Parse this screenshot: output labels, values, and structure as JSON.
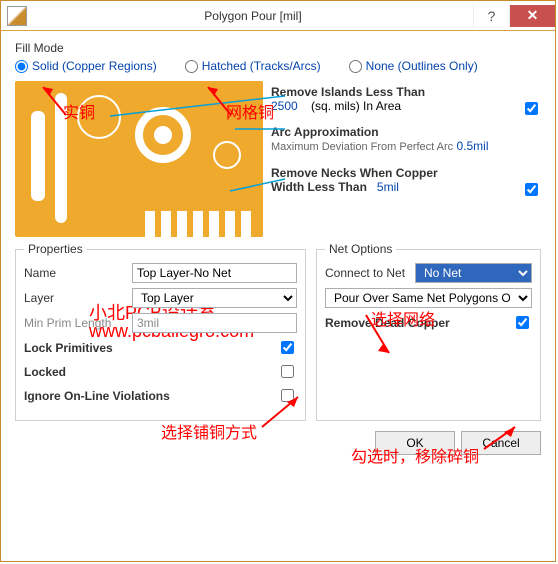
{
  "window": {
    "title": "Polygon Pour [mil]"
  },
  "fill_mode": {
    "label": "Fill Mode",
    "opts": {
      "solid": "Solid (Copper Regions)",
      "hatched": "Hatched (Tracks/Arcs)",
      "none": "None (Outlines Only)"
    },
    "selected": "solid"
  },
  "side": {
    "islands_hdr": "Remove Islands Less Than",
    "islands_val": "2500",
    "islands_unit": "(sq. mils)  In Area",
    "arc_hdr": "Arc Approximation",
    "arc_sub": "Maximum Deviation From Perfect Arc",
    "arc_val": "0.5mil",
    "necks_hdr": "Remove Necks When Copper",
    "necks_sub": "Width Less Than",
    "necks_val": "5mil"
  },
  "props": {
    "legend": "Properties",
    "name": {
      "label": "Name",
      "value": "Top Layer-No Net"
    },
    "layer": {
      "label": "Layer",
      "value": "Top Layer"
    },
    "minlen": {
      "label": "Min Prim Length",
      "value": "3mil"
    },
    "lockprim": {
      "label": "Lock Primitives",
      "checked": true
    },
    "locked": {
      "label": "Locked",
      "checked": false
    },
    "ignore": {
      "label": "Ignore On-Line Violations",
      "checked": false
    }
  },
  "net": {
    "legend": "Net Options",
    "connect": {
      "label": "Connect to Net",
      "value": "No Net"
    },
    "pour": {
      "value": "Pour Over Same Net Polygons Only"
    },
    "dead": {
      "label": "Remove Dead Copper",
      "checked": true
    }
  },
  "buttons": {
    "ok": "OK",
    "cancel": "Cancel"
  },
  "annotations": {
    "solid_cn": "实铜",
    "hatched_cn": "网格铜",
    "studio": "小北PCB设计室",
    "url": "www.pcballegro.com",
    "select_net": "选择网络",
    "pour_mode": "选择铺铜方式",
    "dead_note": "勾选时，移除碎铜"
  }
}
